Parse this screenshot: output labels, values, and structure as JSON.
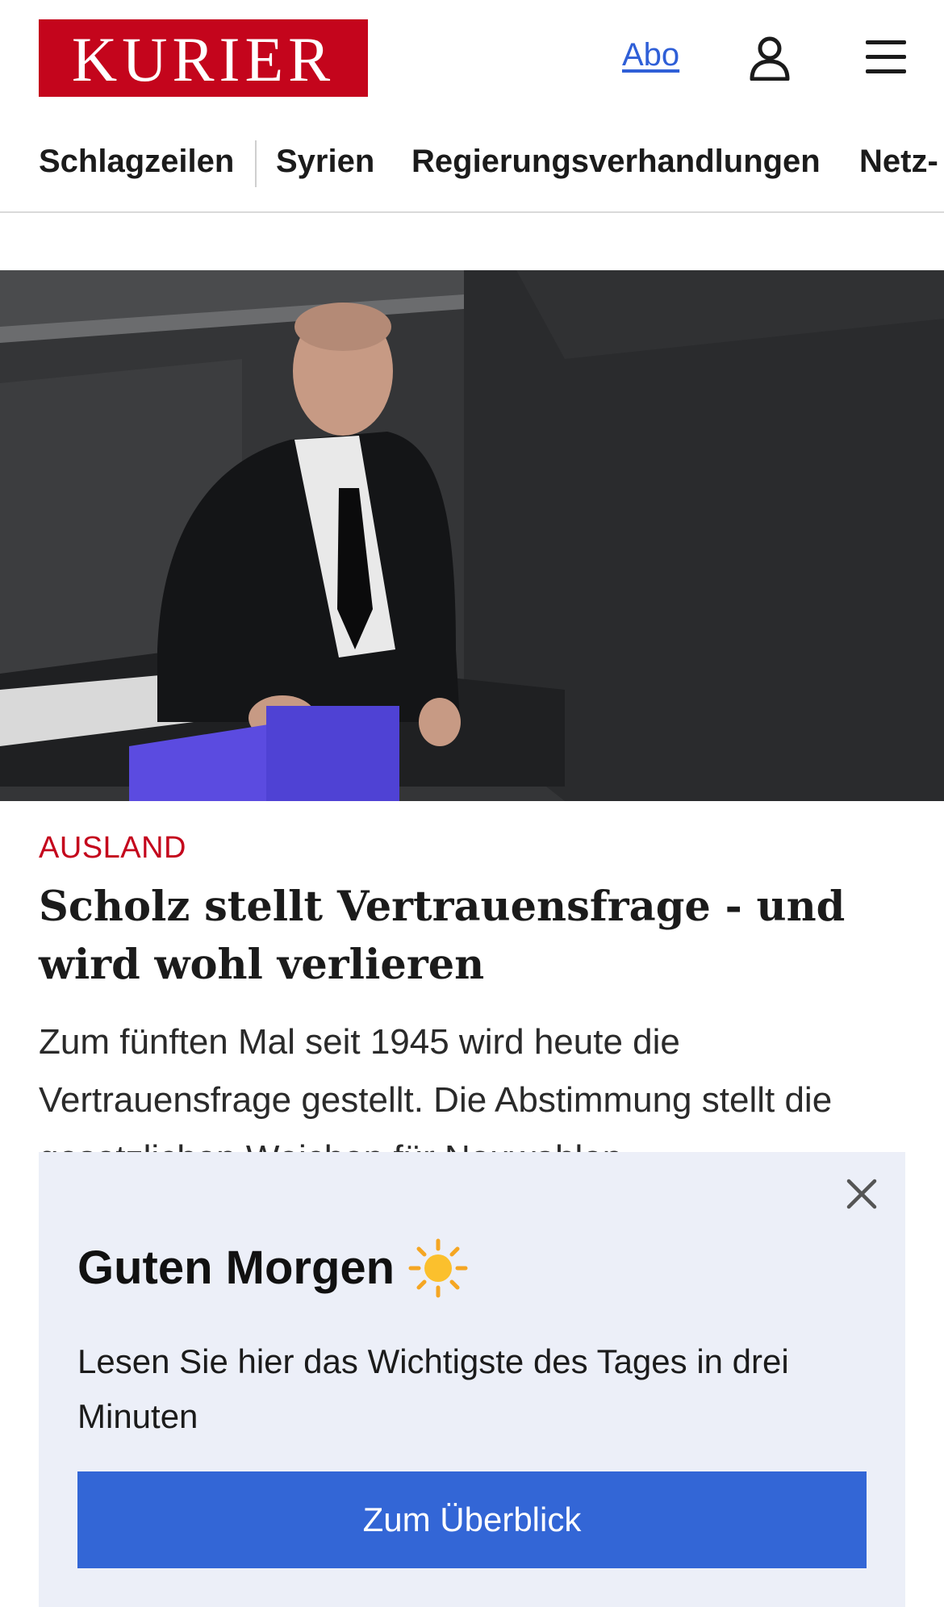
{
  "header": {
    "logo_text": "KURIER",
    "abo_label": "Abo",
    "icons": {
      "user": "user-icon",
      "menu": "hamburger-menu-icon"
    },
    "brand_color": "#c4051c",
    "link_color": "#2f5fd7"
  },
  "nav": {
    "items": [
      {
        "label": "Schlagzeilen"
      },
      {
        "label": "Syrien"
      },
      {
        "label": "Regierungsverhandlungen"
      },
      {
        "label": "Netz-"
      }
    ]
  },
  "article": {
    "category": "AUSLAND",
    "headline": "Scholz stellt Vertrauensfrage - und wird wohl verlieren",
    "teaser": "Zum fünften Mal seit 1945 wird heute die Vertrauensfrage gestellt. Die Abstimmung stellt die gesetzlichen Weichen für Neuwahlen."
  },
  "overlay": {
    "title": "Guten Morgen",
    "title_icon": "sun-icon",
    "text": "Lesen Sie hier das Wichtigste des Tages in drei Minuten",
    "button_label": "Zum Überblick",
    "close_icon": "close-icon",
    "background": "#eceff8",
    "button_color": "#3366d6"
  }
}
